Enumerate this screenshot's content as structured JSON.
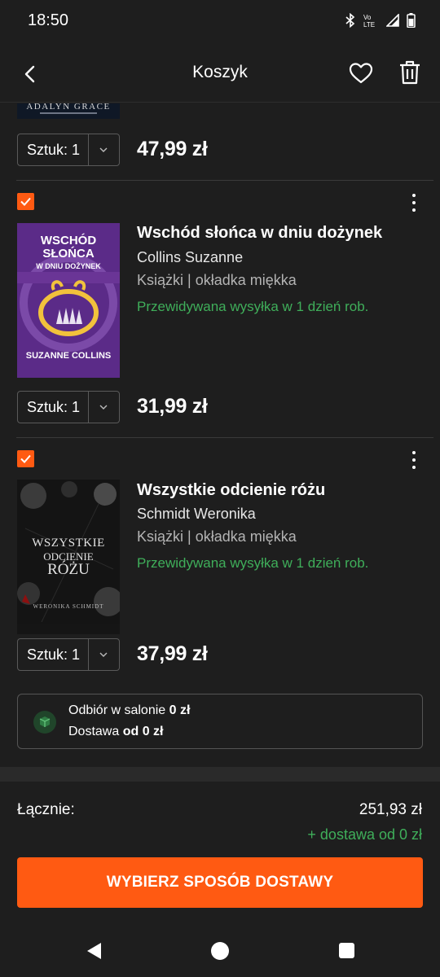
{
  "status_bar": {
    "time": "18:50",
    "icons": [
      "bluetooth-icon",
      "volte-icon",
      "signal-icon",
      "battery-icon"
    ],
    "volte_text": "Vo LTE"
  },
  "app_bar": {
    "title": "Koszyk"
  },
  "colors": {
    "accent": "#ff5a12",
    "success": "#3fae5a",
    "background": "#1e1e1e",
    "text": "#ffffff"
  },
  "cart": {
    "partial_item": {
      "cover_author": "ADALYN GRACE",
      "quantity_label": "Sztuk: 1",
      "price": "47,99 zł"
    },
    "items": [
      {
        "title": "Wschód słońca w dniu dożynek",
        "author": "Collins Suzanne",
        "type": "Książki | okładka miękka",
        "shipping": "Przewidywana wysyłka w 1 dzień rob.",
        "quantity_label": "Sztuk: 1",
        "price": "31,99 zł",
        "checked": true,
        "cover": {
          "line1": "WSCHÓD",
          "line2": "SŁOŃCA",
          "line3": "W DNIU DOŻYNEK",
          "author": "SUZANNE COLLINS"
        }
      },
      {
        "title": "Wszystkie odcienie różu",
        "author": "Schmidt Weronika",
        "type": "Książki | okładka miękka",
        "shipping": "Przewidywana wysyłka w 1 dzień rob.",
        "quantity_label": "Sztuk: 1",
        "price": "37,99 zł",
        "checked": true,
        "cover": {
          "line1": "WSZYSTKIE",
          "line2": "ODCIENIE",
          "line3": "RÓŻU",
          "author": "WERONIKA SCHMIDT"
        }
      }
    ]
  },
  "delivery": {
    "pickup_label": "Odbiór w salonie",
    "pickup_price": "0 zł",
    "delivery_label": "Dostawa",
    "delivery_price": "od 0 zł"
  },
  "summary": {
    "total_label": "Łącznie:",
    "total_value": "251,93 zł",
    "shipping_note": "+ dostawa od 0 zł",
    "cta_label": "WYBIERZ SPOSÓB DOSTAWY"
  }
}
